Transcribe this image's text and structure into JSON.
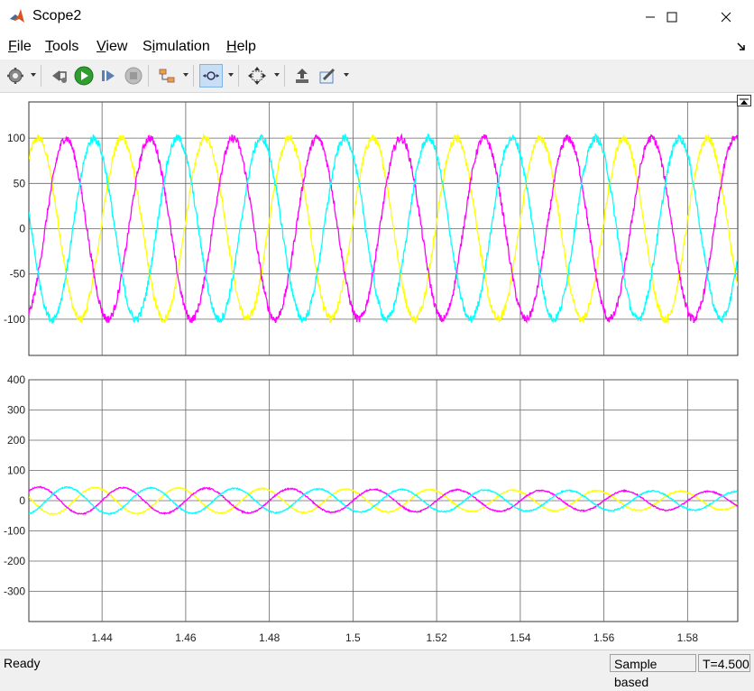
{
  "window": {
    "title": "Scope2"
  },
  "menu": [
    "File",
    "Tools",
    "View",
    "Simulation",
    "Help"
  ],
  "menu_underline": [
    "F",
    "T",
    "V",
    "i",
    "H"
  ],
  "toolbar": {
    "icons": [
      "settings-icon",
      "restore-icon",
      "run-icon",
      "step-forward-icon",
      "stop-icon",
      "signal-selector-icon",
      "zoom-icon",
      "autoscale-icon",
      "cursor-measure-icon",
      "highlight-icon"
    ]
  },
  "colors": {
    "phase_a": "#ffff00",
    "phase_b": "#ff00ff",
    "phase_c": "#00ffff",
    "grid": "#666666",
    "bg": "#ffffff"
  },
  "chart_data": [
    {
      "type": "line",
      "xlim": [
        1.4225,
        1.592
      ],
      "ylim": [
        -140,
        140
      ],
      "yticks": [
        "100",
        "50",
        "0",
        "-50",
        "-100"
      ],
      "ytick_values": [
        100,
        50,
        0,
        -50,
        -100
      ],
      "frequency": 50,
      "series": [
        {
          "color": "#ffff00",
          "amplitude": 100,
          "phase_deg": 5
        },
        {
          "color": "#ff00ff",
          "amplitude": 100,
          "phase_deg": -115
        },
        {
          "color": "#00ffff",
          "amplitude": 100,
          "phase_deg": 125
        }
      ]
    },
    {
      "type": "line",
      "xlim": [
        1.4225,
        1.592
      ],
      "ylim": [
        -400,
        400
      ],
      "yticks": [
        "400",
        "300",
        "200",
        "100",
        "0",
        "-100",
        "-200",
        "-300"
      ],
      "ytick_values": [
        400,
        300,
        200,
        100,
        0,
        -100,
        -200,
        -300
      ],
      "xticks": [
        "1.44",
        "1.46",
        "1.48",
        "1.5",
        "1.52",
        "1.54",
        "1.56",
        "1.58"
      ],
      "xtick_values": [
        1.44,
        1.46,
        1.48,
        1.5,
        1.52,
        1.54,
        1.56,
        1.58
      ],
      "frequency": 50,
      "series": [
        {
          "color": "#ffff00",
          "amplitude": 45,
          "amplitude_end": 30,
          "phase_deg": 120
        },
        {
          "color": "#ff00ff",
          "amplitude": 45,
          "amplitude_end": 30,
          "phase_deg": 0
        },
        {
          "color": "#00ffff",
          "amplitude": 45,
          "amplitude_end": 30,
          "phase_deg": -120
        }
      ]
    }
  ],
  "status": {
    "left": "Ready",
    "mode": "Sample based",
    "time": "T=4.500"
  }
}
